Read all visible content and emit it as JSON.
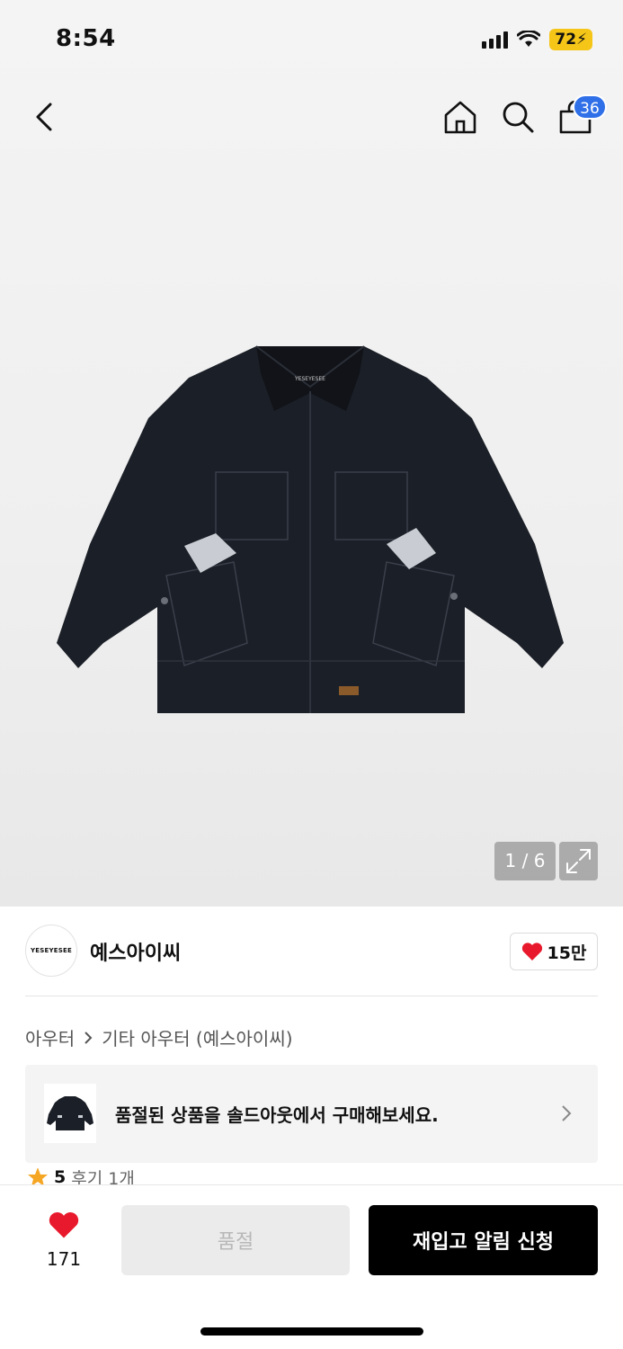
{
  "status_bar": {
    "time": "8:54",
    "battery": "72"
  },
  "nav": {
    "cart_count": "36"
  },
  "product_image": {
    "counter": "1 / 6",
    "jacket_tag": "YESEYESEE"
  },
  "brand": {
    "logo_text": "YESEYESEE",
    "name": "예스아이씨",
    "likes": "15만"
  },
  "breadcrumb": {
    "category": "아우터",
    "subcategory": "기타 아우터 (예스아이씨)"
  },
  "soldout_banner": {
    "text": "품절된 상품을 솔드아웃에서 구매해보세요."
  },
  "rating": {
    "score": "5",
    "reviews": "후기 1개"
  },
  "bottom_bar": {
    "wish_count": "171",
    "soldout_label": "품절",
    "restock_label": "재입고 알림 신청"
  },
  "colors": {
    "accent_blue": "#2f6fe8",
    "heart_red": "#e8192c",
    "battery_yellow": "#f5c518",
    "star_orange": "#f5a623"
  }
}
